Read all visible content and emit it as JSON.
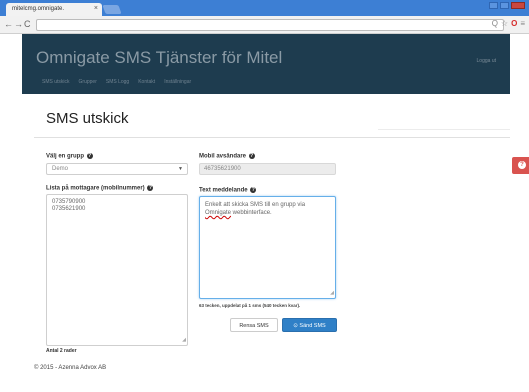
{
  "browser": {
    "tab_title": "mitelcmg.omnigate.",
    "tab_close": "×",
    "nav_back": "←",
    "nav_forward": "→",
    "nav_reload": "C",
    "toolbar_icons": {
      "zoom": "Q",
      "star": "☆",
      "opera": "O",
      "menu": "≡"
    }
  },
  "navbar": {
    "brand": "Omnigate SMS Tjänster för Mitel",
    "login": "Logga ut",
    "menu": [
      "SMS utskick",
      "Grupper",
      "SMS Logg",
      "Kontakt",
      "Inställningar"
    ]
  },
  "page": {
    "title": "SMS utskick"
  },
  "form": {
    "group_label": "Välj en grupp",
    "group_value": "Demo",
    "recipients_label": "Lista på mottagare (mobilnummer)",
    "recipients": [
      "0735790900",
      "0735621900"
    ],
    "count_text": "Antal 2 rader",
    "sender_label": "Mobil avsändare",
    "sender_value": "46735621900",
    "message_label": "Text meddelande",
    "message_text": {
      "part1": "Enkelt att skicka SMS till en grupp via",
      "spellword": "Omnigate",
      "part2": " webbinterface."
    },
    "counter": "63 tecken, uppdelat på 1 sms (540 tecken kvar).",
    "clear_button": "Rensa SMS",
    "send_button": "Sänd SMS",
    "send_icon": "⊙"
  },
  "footer": {
    "copyright": "© 2015 - Azenna Advox AB"
  },
  "help": {
    "icon": "?"
  },
  "colors": {
    "navbar": "#1e3c4f",
    "primary": "#2f80c7",
    "danger": "#d9534f",
    "chrome": "#3d7fd4"
  }
}
